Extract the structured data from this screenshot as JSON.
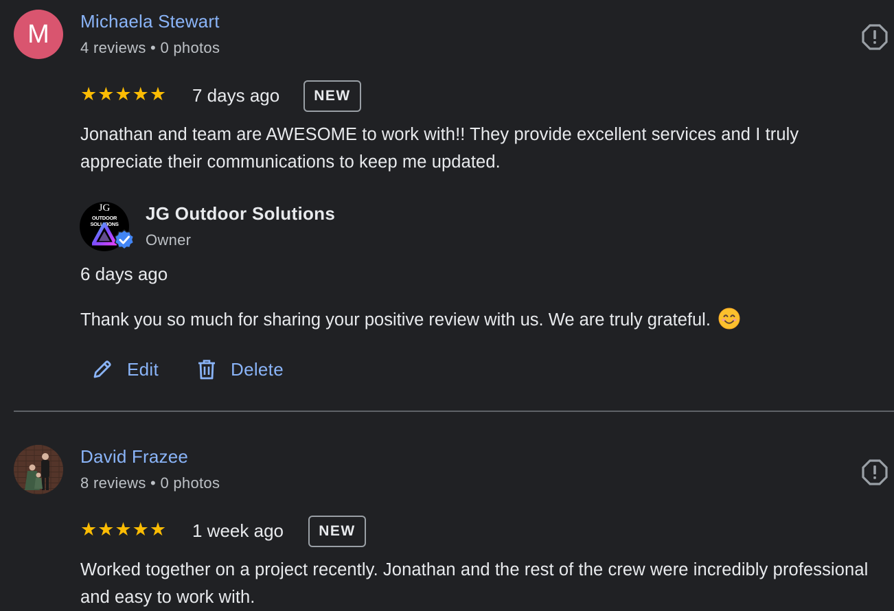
{
  "reviews": [
    {
      "avatar_letter": "M",
      "name": "Michaela Stewart",
      "meta": "4 reviews • 0 photos",
      "stars": "★★★★★",
      "rating": 5,
      "when": "7 days ago",
      "badge": "NEW",
      "text": "Jonathan and team are AWESOME to work with!! They provide excellent services and I truly appreciate their communications to keep me updated.",
      "reply": {
        "logo_line1": "JG",
        "logo_line2": "OUTDOOR SOLUTIONS",
        "owner_name": "JG Outdoor Solutions",
        "owner_role": "Owner",
        "when": "6 days ago",
        "text": "Thank you so much for sharing your positive review with us. We are truly grateful."
      },
      "actions": {
        "edit": "Edit",
        "delete": "Delete"
      }
    },
    {
      "name": "David Frazee",
      "meta": "8 reviews • 0 photos",
      "stars": "★★★★★",
      "rating": 5,
      "when": "1 week ago",
      "badge": "NEW",
      "text": "Worked together on a project recently. Jonathan and the rest of the crew were incredibly professional and easy to work with."
    }
  ],
  "colors": {
    "background": "#202124",
    "link": "#8ab4f8",
    "star": "#fbbc04",
    "avatar_m": "#d9556f"
  },
  "icons": [
    "report-icon",
    "verified-check-icon",
    "pencil-icon",
    "trash-icon",
    "smiling-emoji-icon"
  ]
}
